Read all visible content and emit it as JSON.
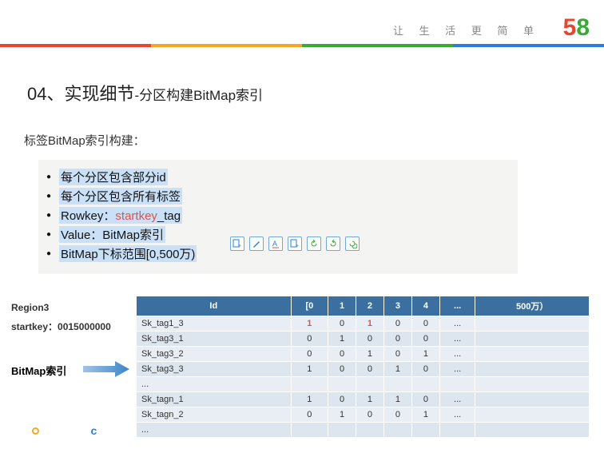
{
  "tagline": "让 生 活 更 简 单",
  "logo": {
    "five": "5",
    "eight": "8"
  },
  "title": {
    "prefix": "04、实现细节",
    "suffix": "-分区构建BitMap索引"
  },
  "subtitle": "标签BitMap索引构建：",
  "bullets": {
    "b1": "每个分区包含部分id",
    "b2": "每个分区包含所有标签",
    "b3_pre": "Rowkey：",
    "b3_sk": "startkey",
    "b3_suf": "_tag",
    "b4": "Value：BitMap索引",
    "b5": "BitMap下标范围[0,500万)"
  },
  "left": {
    "region": "Region3",
    "startkey": "startkey：0015000000",
    "bitmap": "BitMap索引"
  },
  "table": {
    "headers": [
      "Id",
      "[0",
      "1",
      "2",
      "3",
      "4",
      "...",
      "500万）"
    ],
    "rows": [
      {
        "id": "Sk_tag1_3",
        "cells": [
          "1",
          "0",
          "1",
          "0",
          "0",
          "..."
        ],
        "red": [
          0,
          2
        ]
      },
      {
        "id": "Sk_tag3_1",
        "cells": [
          "0",
          "1",
          "0",
          "0",
          "0",
          "..."
        ],
        "red": []
      },
      {
        "id": "Sk_tag3_2",
        "cells": [
          "0",
          "0",
          "1",
          "0",
          "1",
          "..."
        ],
        "red": []
      },
      {
        "id": "Sk_tag3_3",
        "cells": [
          "1",
          "0",
          "0",
          "1",
          "0",
          "..."
        ],
        "red": []
      },
      {
        "id": "...",
        "cells": [
          "",
          "",
          "",
          "",
          "",
          ""
        ],
        "red": []
      },
      {
        "id": "Sk_tagn_1",
        "cells": [
          "1",
          "0",
          "1",
          "1",
          "0",
          "..."
        ],
        "red": []
      },
      {
        "id": "Sk_tagn_2",
        "cells": [
          "0",
          "1",
          "0",
          "0",
          "1",
          "..."
        ],
        "red": []
      },
      {
        "id": "...",
        "cells": [
          "",
          "",
          "",
          "",
          "",
          ""
        ],
        "red": []
      }
    ]
  },
  "colors": {
    "bar": [
      "#e8442e",
      "#f5a623",
      "#3aa935",
      "#2a7de1"
    ]
  }
}
